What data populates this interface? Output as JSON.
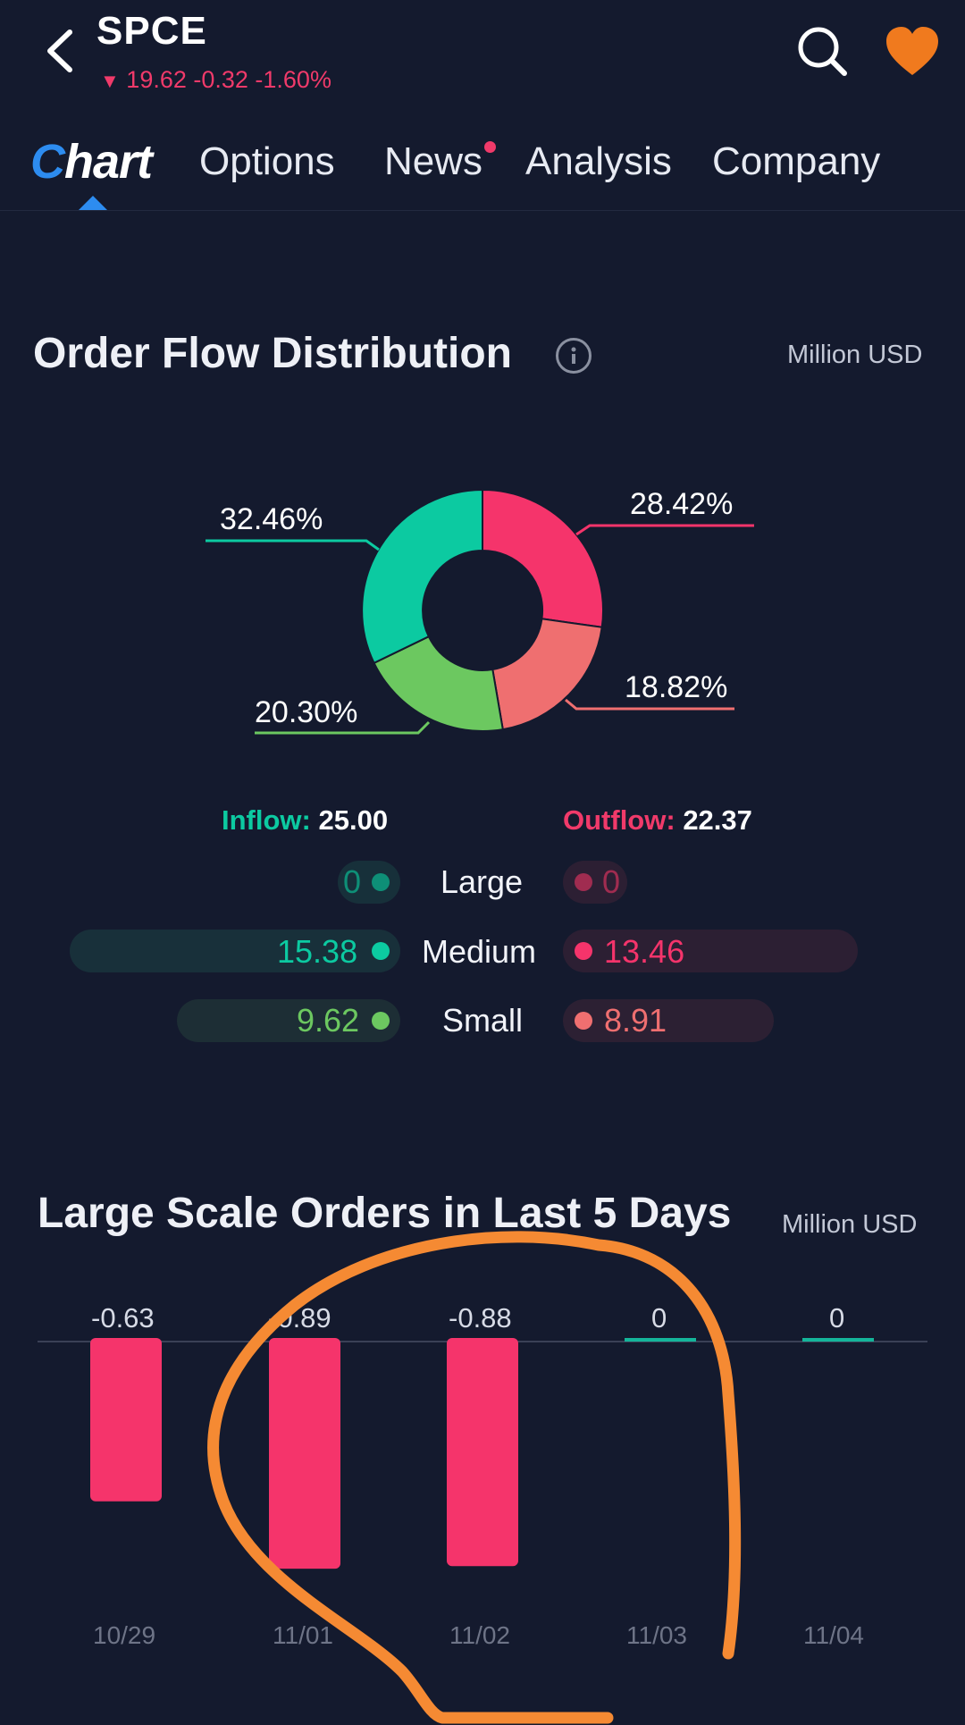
{
  "header": {
    "ticker": "SPCE",
    "price_line": "19.62 -0.32 -1.60%",
    "back_icon": "chevron-left-icon",
    "search_icon": "search-icon",
    "favorite_icon": "heart-icon",
    "accent_down": "#f03a6a",
    "favorite_color": "#f07a1e"
  },
  "tabs": {
    "chart_first": "C",
    "chart_rest": "hart",
    "options": "Options",
    "news": "News",
    "analysis": "Analysis",
    "company": "Company"
  },
  "order_flow": {
    "title": "Order Flow Distribution",
    "unit": "Million USD",
    "donut": {
      "labels": [
        "32.46%",
        "28.42%",
        "18.82%",
        "20.30%"
      ],
      "colors": {
        "inflow_medium": "#0ccaa1",
        "outflow_medium": "#f5346b",
        "outflow_small": "#ef6f70",
        "inflow_small": "#6cc860"
      }
    },
    "inflow_label": "Inflow:",
    "inflow_value": "25.00",
    "outflow_label": "Outflow:",
    "outflow_value": "22.37",
    "rows": [
      {
        "label": "Large",
        "in": "0",
        "out": "0"
      },
      {
        "label": "Medium",
        "in": "15.38",
        "out": "13.46"
      },
      {
        "label": "Small",
        "in": "9.62",
        "out": "8.91"
      }
    ]
  },
  "large_orders": {
    "title": "Large Scale Orders in Last 5 Days",
    "unit": "Million USD",
    "bar_labels": [
      "-0.63",
      "-0.89",
      "-0.88",
      "0",
      "0"
    ],
    "dates": [
      "10/29",
      "11/01",
      "11/02",
      "11/03",
      "11/04"
    ]
  },
  "chart_data": {
    "type": "bar",
    "categories": [
      "10/29",
      "11/01",
      "11/02",
      "11/03",
      "11/04"
    ],
    "values": [
      -0.63,
      -0.89,
      -0.88,
      0,
      0
    ],
    "title": "Large Scale Orders in Last 5 Days",
    "ylabel": "Million USD",
    "colors": {
      "negative": "#f5346b",
      "zero": "#14b59a"
    }
  }
}
